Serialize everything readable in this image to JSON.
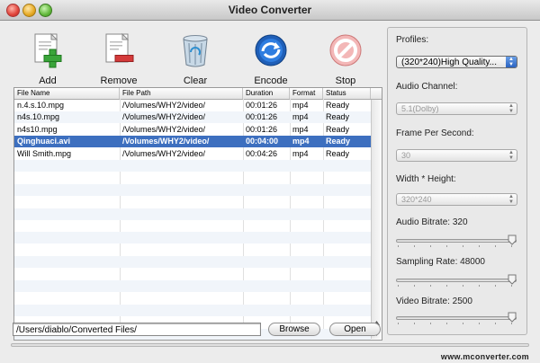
{
  "window": {
    "title": "Video Converter"
  },
  "toolbar": {
    "add": "Add",
    "remove": "Remove",
    "clear": "Clear",
    "encode": "Encode",
    "stop": "Stop"
  },
  "table": {
    "headers": [
      "File Name",
      "File Path",
      "Duration",
      "Format",
      "Status"
    ],
    "rows": [
      {
        "name": "n.4.s.10.mpg",
        "path": "/Volumes/WHY2/video/",
        "duration": "00:01:26",
        "format": "mp4",
        "status": "Ready"
      },
      {
        "name": "n4s.10.mpg",
        "path": "/Volumes/WHY2/video/",
        "duration": "00:01:26",
        "format": "mp4",
        "status": "Ready"
      },
      {
        "name": "n4s10.mpg",
        "path": "/Volumes/WHY2/video/",
        "duration": "00:01:26",
        "format": "mp4",
        "status": "Ready"
      },
      {
        "name": "Qinghuaci.avi",
        "path": "/Volumes/WHY2/video/",
        "duration": "00:04:00",
        "format": "mp4",
        "status": "Ready"
      },
      {
        "name": "Will Smith.mpg",
        "path": "/Volumes/WHY2/video/",
        "duration": "00:04:26",
        "format": "mp4",
        "status": "Ready"
      }
    ],
    "selected_row": 3
  },
  "output": {
    "path": "/Users/diablo/Converted Files/",
    "browse": "Browse",
    "open": "Open"
  },
  "settings": {
    "profiles_label": "Profiles:",
    "profiles_value": "(320*240)High Quality...",
    "audio_channel_label": "Audio Channel:",
    "audio_channel_value": "5.1(Dolby)",
    "fps_label": "Frame Per Second:",
    "fps_value": "30",
    "size_label": "Width * Height:",
    "size_value": "320*240",
    "audio_bitrate_label": "Audio Bitrate:",
    "audio_bitrate_value": "320",
    "sampling_rate_label": "Sampling Rate:",
    "sampling_rate_value": "48000",
    "video_bitrate_label": "Video Bitrate:",
    "video_bitrate_value": "2500"
  },
  "footer": {
    "url": "www.mconverter.com"
  },
  "colors": {
    "selection": "#3d6fbf",
    "accent_blue": "#2a62c0"
  }
}
